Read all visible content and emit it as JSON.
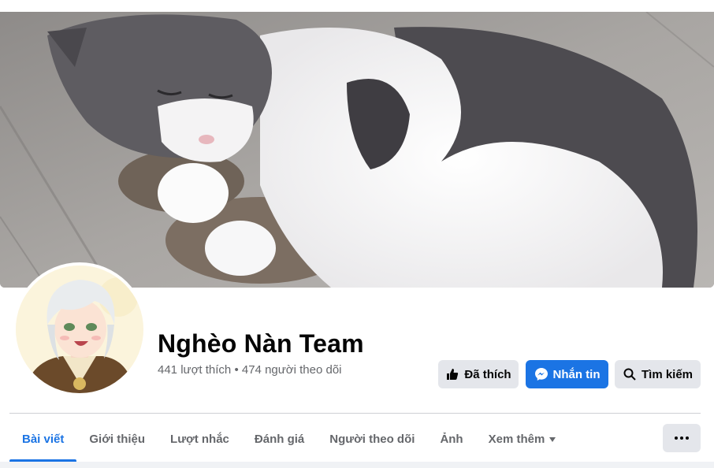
{
  "page": {
    "name": "Nghèo Nàn Team",
    "likes": "441 lượt thích",
    "separator": "•",
    "followers": "474 người theo dõi"
  },
  "actions": {
    "like_label": "Đã thích",
    "message_label": "Nhắn tin",
    "search_label": "Tìm kiếm"
  },
  "tabs": [
    {
      "label": "Bài viết",
      "active": true
    },
    {
      "label": "Giới thiệu",
      "active": false
    },
    {
      "label": "Lượt nhắc",
      "active": false
    },
    {
      "label": "Đánh giá",
      "active": false
    },
    {
      "label": "Người theo dõi",
      "active": false
    },
    {
      "label": "Ảnh",
      "active": false
    },
    {
      "label": "Xem thêm",
      "active": false
    }
  ],
  "icons": {
    "like": "thumbs-up-icon",
    "message": "messenger-icon",
    "search": "search-icon",
    "more_tab": "caret-down-icon",
    "more_button": "ellipsis-icon"
  },
  "colors": {
    "accent": "#1b74e4",
    "button_gray": "#e4e6eb",
    "secondary_text": "#65676b"
  }
}
